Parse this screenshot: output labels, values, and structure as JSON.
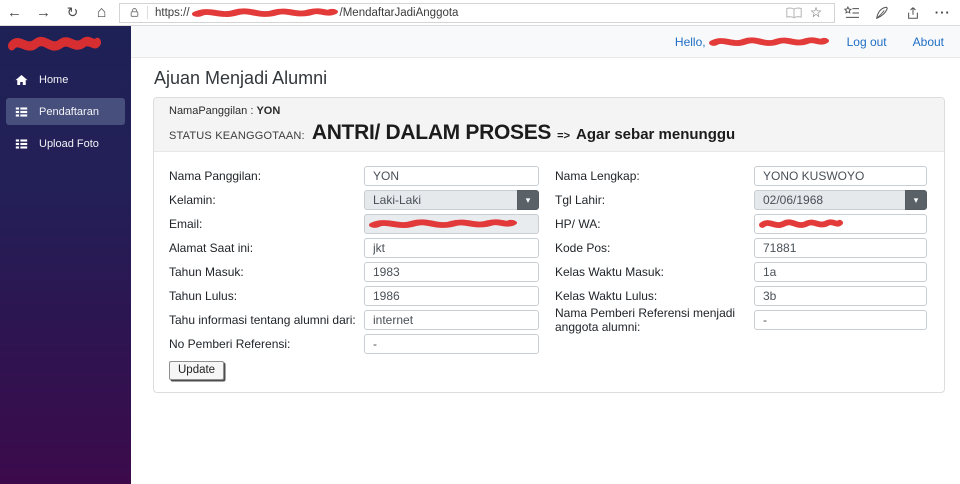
{
  "browser": {
    "back": "←",
    "forward": "→",
    "refresh": "↻",
    "home": "⌂",
    "url": {
      "protocol": "https://",
      "path_suffix": "/MendaftarJadiAnggota"
    },
    "star": "☆",
    "ellipsis": "···"
  },
  "topbar": {
    "greeting": "Hello,",
    "logout": "Log out",
    "about": "About"
  },
  "sidebar": {
    "items": [
      {
        "label": "Home",
        "icon": "home-icon",
        "active": false
      },
      {
        "label": "Pendaftaran",
        "icon": "list-icon",
        "active": true
      },
      {
        "label": "Upload Foto",
        "icon": "list-icon",
        "active": false
      }
    ]
  },
  "main": {
    "title": "Ajuan Menjadi Alumni",
    "status": {
      "nickname_label": "NamaPanggilan :",
      "nickname_value": "YON",
      "status_label": "STATUS KEANGGOTAAN:",
      "status_value": "ANTRI/ DALAM PROSES",
      "arrow": "=>",
      "note": "Agar sebar menunggu"
    },
    "form": {
      "select_caret": "▾",
      "update_label": "Update",
      "left": [
        {
          "name": "nama-panggilan",
          "label": "Nama Panggilan:",
          "value": "YON",
          "type": "text"
        },
        {
          "name": "kelamin",
          "label": "Kelamin:",
          "value": "Laki-Laki",
          "type": "select"
        },
        {
          "name": "email",
          "label": "Email:",
          "value": "",
          "type": "disabled",
          "redacted": true,
          "redact_w": 148
        },
        {
          "name": "alamat-saat-ini",
          "label": "Alamat Saat ini:",
          "value": "jkt",
          "type": "text"
        },
        {
          "name": "tahun-masuk",
          "label": "Tahun Masuk:",
          "value": "1983",
          "type": "text"
        },
        {
          "name": "tahun-lulus",
          "label": "Tahun Lulus:",
          "value": "1986",
          "type": "text"
        },
        {
          "name": "tahu-informasi-tentang-alumni-dari",
          "label": "Tahu informasi tentang alumni dari:",
          "value": "internet",
          "type": "text"
        },
        {
          "name": "no-pemberi-referensi",
          "label": "No Pemberi Referensi:",
          "value": "-",
          "type": "text"
        }
      ],
      "right": [
        {
          "name": "nama-lengkap",
          "label": "Nama Lengkap:",
          "value": "YONO KUSWOYO",
          "type": "text"
        },
        {
          "name": "tgl-lahir",
          "label": "Tgl Lahir:",
          "value": "02/06/1968",
          "type": "select"
        },
        {
          "name": "hp-wa",
          "label": "HP/ WA:",
          "value": "",
          "type": "text",
          "redacted": true,
          "redact_w": 84
        },
        {
          "name": "kode-pos",
          "label": "Kode Pos:",
          "value": "71881",
          "type": "text"
        },
        {
          "name": "kelas-waktu-masuk",
          "label": "Kelas Waktu Masuk:",
          "value": "1a",
          "type": "text"
        },
        {
          "name": "kelas-waktu-lulus",
          "label": "Kelas Waktu Lulus:",
          "value": "3b",
          "type": "text"
        },
        {
          "name": "nama-pemberi-referensi-menjadi-anggota-alumni",
          "label": "Nama Pemberi Referensi menjadi anggota alumni:",
          "value": "-",
          "type": "text"
        }
      ]
    }
  },
  "colors": {
    "link_blue": "#1f6fc5",
    "sidebar_top": "#1e2156",
    "sidebar_bottom": "#3c0a4b",
    "sidebar_active": "#47507d",
    "redaction_red": "#e12f2f",
    "status_bg": "#f4f4f4",
    "disabled_field_bg": "#e9ecef",
    "select_button_bg": "#5a6268"
  }
}
